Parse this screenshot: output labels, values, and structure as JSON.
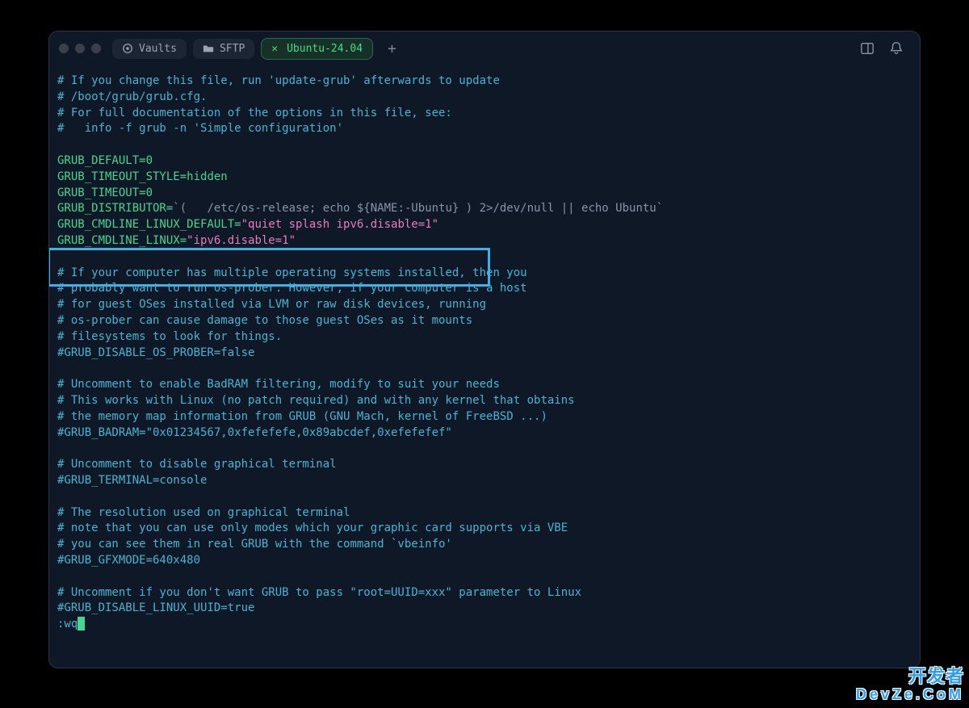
{
  "tabs": {
    "vaults": "Vaults",
    "sftp": "SFTP",
    "active": "Ubuntu-24.04"
  },
  "file": {
    "header": [
      "# If you change this file, run 'update-grub' afterwards to update",
      "# /boot/grub/grub.cfg.",
      "# For full documentation of the options in this file, see:",
      "#   info -f grub -n 'Simple configuration'"
    ],
    "settings": {
      "default_key": "GRUB_DEFAULT",
      "default_val": "0",
      "timeout_style_key": "GRUB_TIMEOUT_STYLE",
      "timeout_style_val": "hidden",
      "timeout_key": "GRUB_TIMEOUT",
      "timeout_val": "0",
      "distributor_key": "GRUB_DISTRIBUTOR",
      "distributor_val": "`(   /etc/os-release; echo ${NAME:-Ubuntu} ) 2>/dev/null || echo Ubuntu`",
      "cmdline_default_key": "GRUB_CMDLINE_LINUX_DEFAULT",
      "cmdline_default_val": "\"quiet splash ipv6.disable=1\"",
      "cmdline_key": "GRUB_CMDLINE_LINUX",
      "cmdline_val": "\"ipv6.disable=1\""
    },
    "os_prober_block": [
      "# If your computer has multiple operating systems installed, then you",
      "# probably want to run os-prober. However, if your computer is a host",
      "# for guest OSes installed via LVM or raw disk devices, running",
      "# os-prober can cause damage to those guest OSes as it mounts",
      "# filesystems to look for things.",
      "#GRUB_DISABLE_OS_PROBER=false"
    ],
    "badram_block": [
      "# Uncomment to enable BadRAM filtering, modify to suit your needs",
      "# This works with Linux (no patch required) and with any kernel that obtains",
      "# the memory map information from GRUB (GNU Mach, kernel of FreeBSD ...)",
      "#GRUB_BADRAM=\"0x01234567,0xfefefefe,0x89abcdef,0xefefefef\""
    ],
    "terminal_block": [
      "# Uncomment to disable graphical terminal",
      "#GRUB_TERMINAL=console"
    ],
    "gfx_block": [
      "# The resolution used on graphical terminal",
      "# note that you can use only modes which your graphic card supports via VBE",
      "# you can see them in real GRUB with the command `vbeinfo'",
      "#GRUB_GFXMODE=640x480"
    ],
    "uuid_block": [
      "# Uncomment if you don't want GRUB to pass \"root=UUID=xxx\" parameter to Linux",
      "#GRUB_DISABLE_LINUX_UUID=true"
    ]
  },
  "vi_command": ":wq",
  "watermark": {
    "line1": "开发者",
    "line2": "DevZe.CoM"
  }
}
